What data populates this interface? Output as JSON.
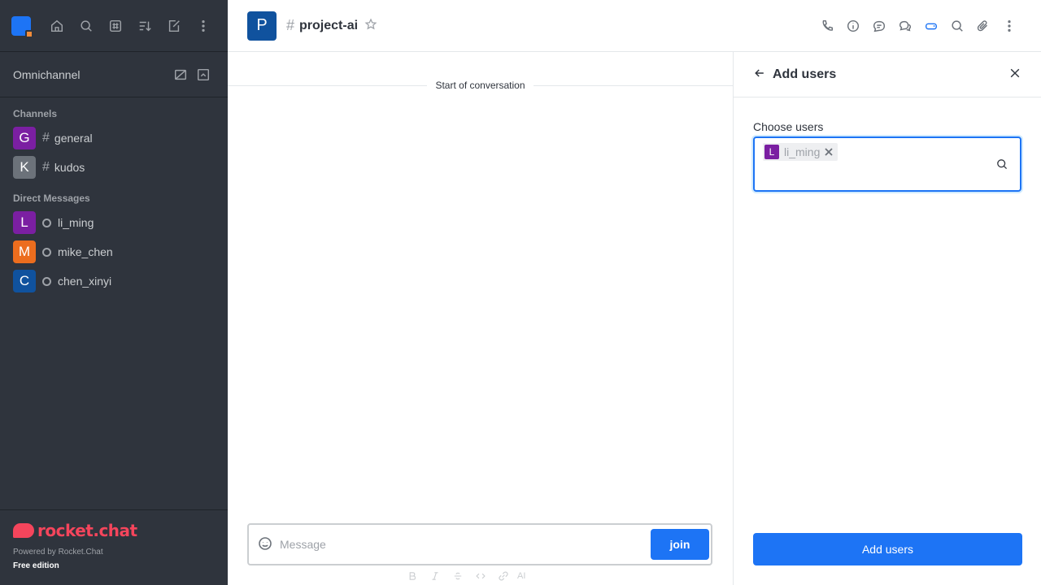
{
  "colors": {
    "accent": "#1d74f5",
    "sidebar_bg": "#2f343d",
    "brand": "#f5455c"
  },
  "sidebar": {
    "header_icons": [
      "home-icon",
      "search-icon",
      "directory-icon",
      "sort-icon",
      "create-new-icon",
      "kebab-icon"
    ],
    "omnichannel": {
      "label": "Omnichannel",
      "icons": [
        "contact-center-icon",
        "queue-icon"
      ]
    },
    "channels_title": "Channels",
    "channels": [
      {
        "avatar": "G",
        "color": "#7b1fa2",
        "name": "general"
      },
      {
        "avatar": "K",
        "color": "#6c727a",
        "name": "kudos"
      }
    ],
    "dm_title": "Direct Messages",
    "dms": [
      {
        "avatar": "L",
        "color": "#7b1fa2",
        "name": "li_ming"
      },
      {
        "avatar": "M",
        "color": "#ec6d1e",
        "name": "mike_chen"
      },
      {
        "avatar": "C",
        "color": "#10529e",
        "name": "chen_xinyi"
      }
    ],
    "footer": {
      "logo_text": "rocket.chat",
      "powered": "Powered by Rocket.Chat",
      "edition": "Free edition"
    }
  },
  "header": {
    "room_avatar": "P",
    "room_name": "project-ai",
    "actions": [
      "call-icon",
      "info-icon",
      "threads-icon",
      "discussion-icon",
      "team-icon",
      "search-icon",
      "attachment-icon",
      "kebab-icon"
    ]
  },
  "main": {
    "start_divider": "Start of conversation",
    "composer": {
      "placeholder": "Message",
      "join_label": "join",
      "ai_label": "AI"
    }
  },
  "contextual": {
    "title": "Add users",
    "field_label": "Choose users",
    "selected": [
      {
        "avatar": "L",
        "name": "li_ming"
      }
    ],
    "submit_label": "Add users"
  }
}
